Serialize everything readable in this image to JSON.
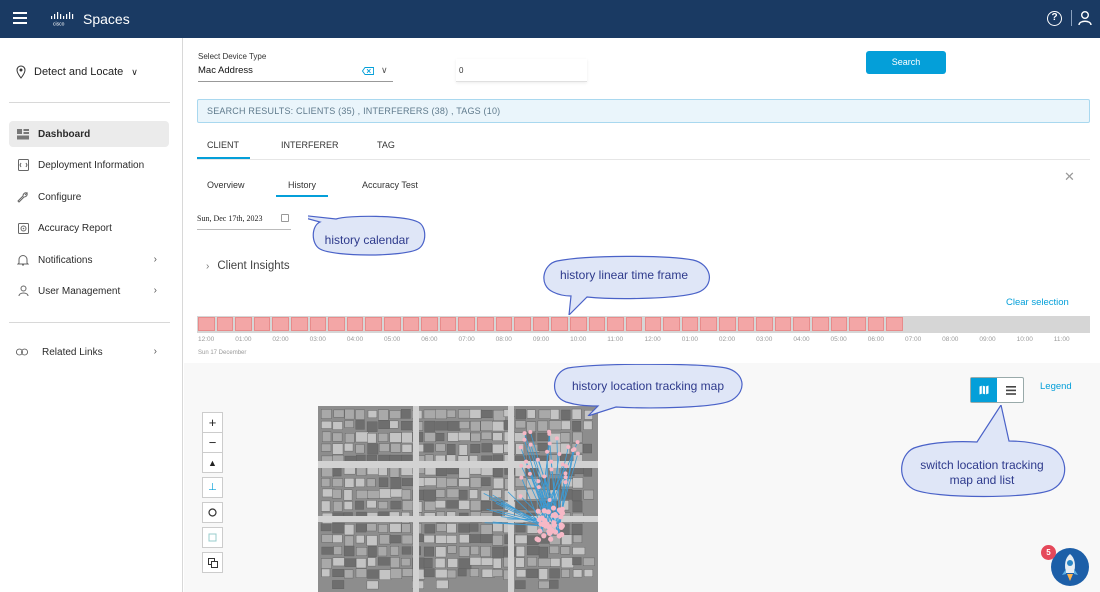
{
  "app": {
    "name": "Spaces",
    "brand": "cisco"
  },
  "sidebar": {
    "section": "Detect and Locate",
    "items": [
      {
        "label": "Dashboard",
        "icon": "dashboard-icon",
        "active": true
      },
      {
        "label": "Deployment Information",
        "icon": "deployment-icon"
      },
      {
        "label": "Configure",
        "icon": "wrench-icon"
      },
      {
        "label": "Accuracy Report",
        "icon": "target-icon"
      },
      {
        "label": "Notifications",
        "icon": "bell-icon"
      },
      {
        "label": "User Management",
        "icon": "user-icon"
      }
    ],
    "related": "Related Links"
  },
  "search": {
    "device_type_label": "Select Device Type",
    "device_type_value": "Mac Address",
    "input_value": "0",
    "button_label": "Search"
  },
  "results": {
    "text": "SEARCH RESULTS: CLIENTS (35) , INTERFERERS (38) , TAGS (10)"
  },
  "tabs": [
    "CLIENT",
    "INTERFERER",
    "TAG"
  ],
  "subtabs": [
    "Overview",
    "History",
    "Accuracy Test"
  ],
  "history": {
    "date": "Sun, Dec 17th, 2023",
    "insights_label": "Client Insights",
    "clear_selection": "Clear selection",
    "selected_hours": 38,
    "ticks": [
      "12:00",
      "01:00",
      "02:00",
      "03:00",
      "04:00",
      "05:00",
      "06:00",
      "07:00",
      "08:00",
      "09:00",
      "10:00",
      "11:00",
      "12:00",
      "01:00",
      "02:00",
      "03:00",
      "04:00",
      "05:00",
      "06:00",
      "07:00",
      "08:00",
      "09:00",
      "10:00",
      "11:00"
    ],
    "date_sub": "Sun 17 December"
  },
  "map": {
    "legend_label": "Legend"
  },
  "annotations": {
    "calendar": "history calendar",
    "timeframe": "history linear time frame",
    "tracking_map": "history location tracking map",
    "switch_1": "switch location tracking",
    "switch_2": "map and list"
  },
  "notifications": {
    "badge": "5"
  },
  "colors": {
    "topbar": "#1a3a63",
    "accent": "#049fd9",
    "timeline_fill": "#f3a6a6",
    "callout_fill": "#dfe6f7",
    "callout_stroke": "#4a62c8"
  }
}
